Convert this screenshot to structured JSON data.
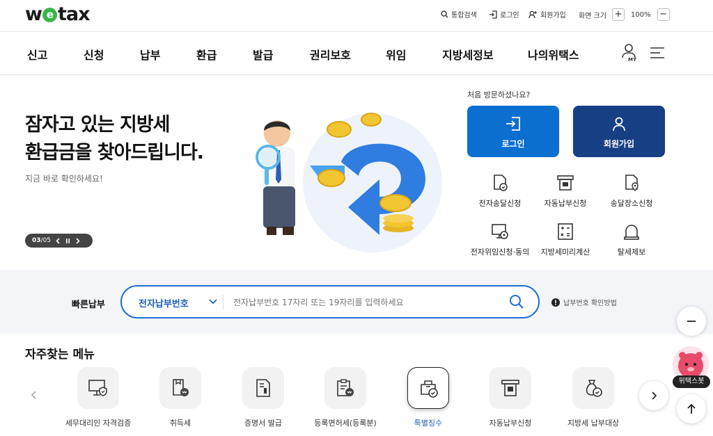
{
  "header": {
    "logo": "wetax",
    "logo_parts": {
      "w": "w",
      "e": "e",
      "rest": "tax"
    },
    "search_label": "통합검색",
    "login_label": "로그인",
    "signup_label": "회원가입",
    "screen_size_label": "화면 크기",
    "zoom_plus": "+",
    "zoom_level": "100%",
    "zoom_minus": "−"
  },
  "nav": {
    "items": [
      "신고",
      "신청",
      "납부",
      "환급",
      "발급",
      "권리보호",
      "위임",
      "지방세정보",
      "나의위택스"
    ],
    "my_label": "MY"
  },
  "hero": {
    "title_line1": "잠자고 있는 지방세",
    "title_line2": "환급금을 찾아드립니다.",
    "subtitle": "지금 바로 확인하세요!",
    "pager_current": "03",
    "pager_sep": "/",
    "pager_total": "05"
  },
  "account": {
    "first_visit": "처음 방문하셨나요?",
    "login_button": "로그인",
    "signup_button": "회원가입"
  },
  "services": [
    {
      "label": "전자송달신청",
      "icon": "e-delivery-icon"
    },
    {
      "label": "자동납부신청",
      "icon": "auto-payment-icon"
    },
    {
      "label": "송달장소신청",
      "icon": "delivery-place-icon"
    },
    {
      "label": "전자위임신청·동의",
      "icon": "e-delegation-icon"
    },
    {
      "label": "지방세미리계산",
      "icon": "calculator-icon"
    },
    {
      "label": "탈세제보",
      "icon": "alarm-bell-icon"
    }
  ],
  "quick_pay": {
    "label": "빠른납부",
    "select_value": "전자납부번호",
    "placeholder": "전자납부번호 17자리 또는 19자리를 입력하세요",
    "howto": "납부번호 확인방법"
  },
  "favorites": {
    "title": "자주찾는 메뉴",
    "items": [
      {
        "label": "세무대리인 자격검증",
        "icon": "monitor-shield-icon"
      },
      {
        "label": "취득세",
        "icon": "document-coin-icon"
      },
      {
        "label": "증명서 발급",
        "icon": "certificate-icon"
      },
      {
        "label": "등록면허세(등록분)",
        "icon": "clipboard-coin-icon"
      },
      {
        "label": "특별징수",
        "icon": "box-check-icon",
        "active": true
      },
      {
        "label": "자동납부신청",
        "icon": "auto-payment-icon"
      },
      {
        "label": "지방세 납부대상",
        "icon": "money-bag-icon"
      }
    ]
  },
  "chatbot_label": "위택스봇",
  "colors": {
    "primary_blue": "#0b6fcf",
    "navy": "#173f84",
    "input_border": "#1f6fd0",
    "logo_green": "#3bb54a"
  }
}
